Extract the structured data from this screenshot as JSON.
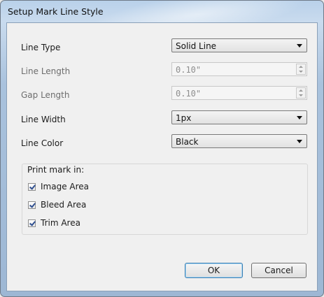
{
  "window": {
    "title": "Setup Mark Line Style"
  },
  "fields": {
    "line_type": {
      "label": "Line Type",
      "value": "Solid Line"
    },
    "line_length": {
      "label": "Line Length",
      "value": "0.10\""
    },
    "gap_length": {
      "label": "Gap Length",
      "value": "0.10\""
    },
    "line_width": {
      "label": "Line Width",
      "value": "1px"
    },
    "line_color": {
      "label": "Line Color",
      "value": "Black"
    }
  },
  "print_mark": {
    "label": "Print mark in:",
    "options": [
      {
        "label": "Image Area",
        "checked": true
      },
      {
        "label": "Bleed Area",
        "checked": true
      },
      {
        "label": "Trim Area",
        "checked": true
      }
    ]
  },
  "buttons": {
    "ok": "OK",
    "cancel": "Cancel"
  }
}
